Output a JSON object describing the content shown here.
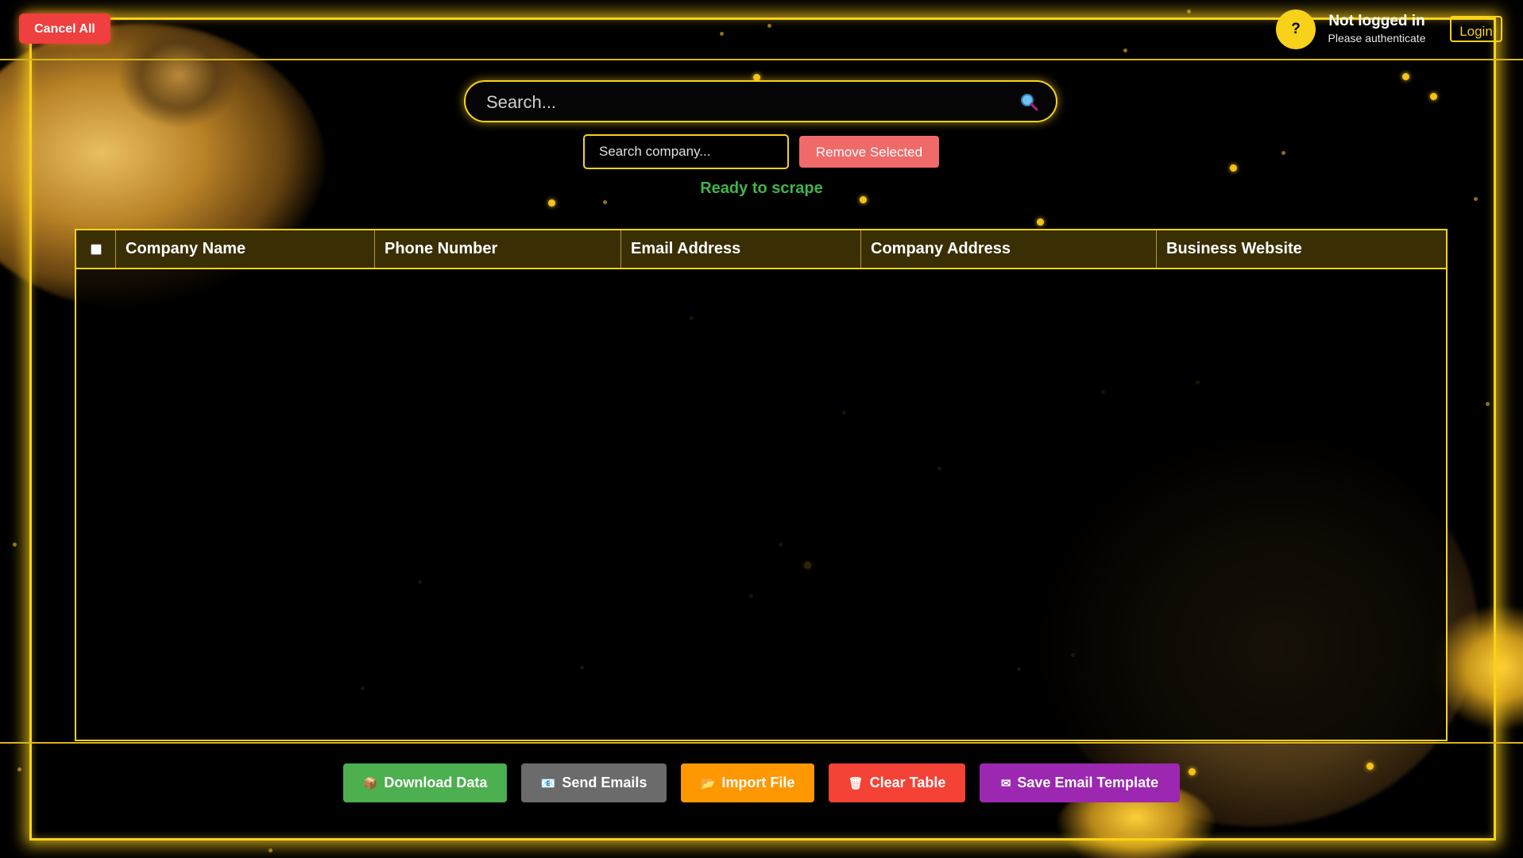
{
  "header": {
    "cancel_all_label": "Cancel All",
    "help_label": "?",
    "auth_title": "Not logged in",
    "auth_subtitle": "Please authenticate",
    "login_label": "Login"
  },
  "search": {
    "placeholder": "Search...",
    "icon": "magnifier-icon"
  },
  "company_filter": {
    "placeholder": "Search company...",
    "remove_selected_label": "Remove Selected"
  },
  "status": {
    "text": "Ready to scrape",
    "color": "#3fb54a"
  },
  "table": {
    "columns": [
      "Company Name",
      "Phone Number",
      "Email Address",
      "Company Address",
      "Business Website"
    ],
    "rows": []
  },
  "actions": {
    "download_label": "Download Data",
    "send_label": "Send Emails",
    "import_label": "Import File",
    "clear_label": "Clear Table",
    "template_label": "Save Email Template"
  },
  "colors": {
    "accent": "#f7d21b",
    "background": "#000000",
    "download": "#4caf50",
    "send": "#6b6b6b",
    "import": "#ff9800",
    "clear": "#f44336",
    "template": "#9c27b0",
    "cancel": "#ef3f3f",
    "remove": "#f06a6a"
  }
}
